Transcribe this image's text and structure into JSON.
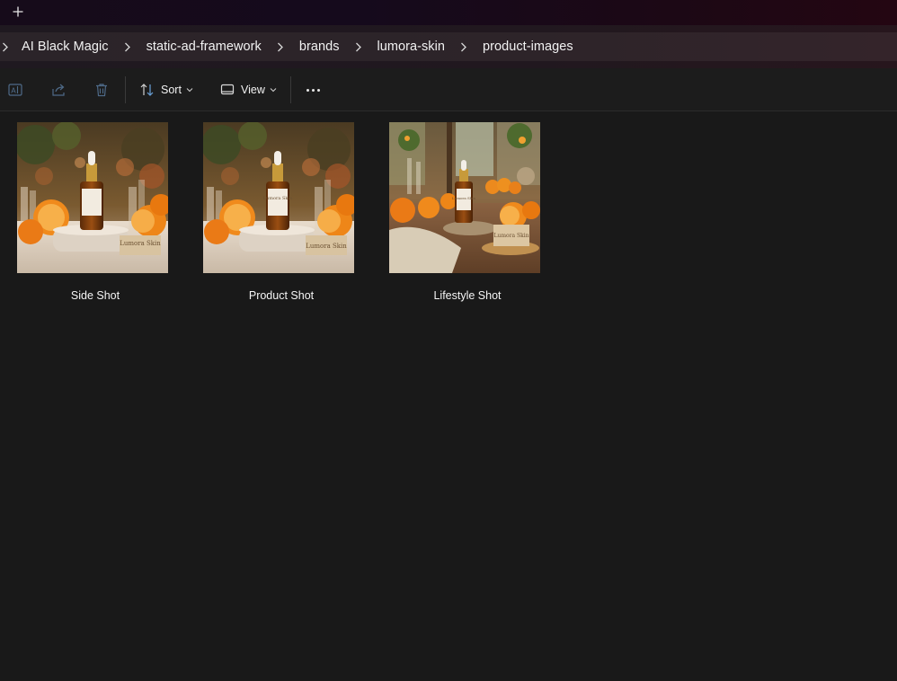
{
  "titlebar": {
    "new_tab_icon": "plus-icon"
  },
  "breadcrumb": [
    "AI Black Magic",
    "static-ad-framework",
    "brands",
    "lumora-skin",
    "product-images"
  ],
  "commandbar": {
    "icons": [
      "rename-icon",
      "share-icon",
      "delete-icon"
    ],
    "sort_label": "Sort",
    "view_label": "View",
    "more_icon": "more-icon"
  },
  "files": [
    {
      "label": "Side Shot",
      "thumbnail": "bottle-on-marble-oranges",
      "bottle_label": "Lumora Skin"
    },
    {
      "label": "Product Shot",
      "thumbnail": "bottle-on-marble-oranges",
      "bottle_label": "Lumora Skin"
    },
    {
      "label": "Lifestyle Shot",
      "thumbnail": "bottle-on-wood-table-oranges",
      "bottle_label": "Lumora Skin"
    }
  ],
  "colors": {
    "background": "#191919",
    "commandbar": "#1c1c1c",
    "addressbar": "#2b2429",
    "text": "#f2f2f2",
    "icon_disabled": "#4e6a88"
  }
}
